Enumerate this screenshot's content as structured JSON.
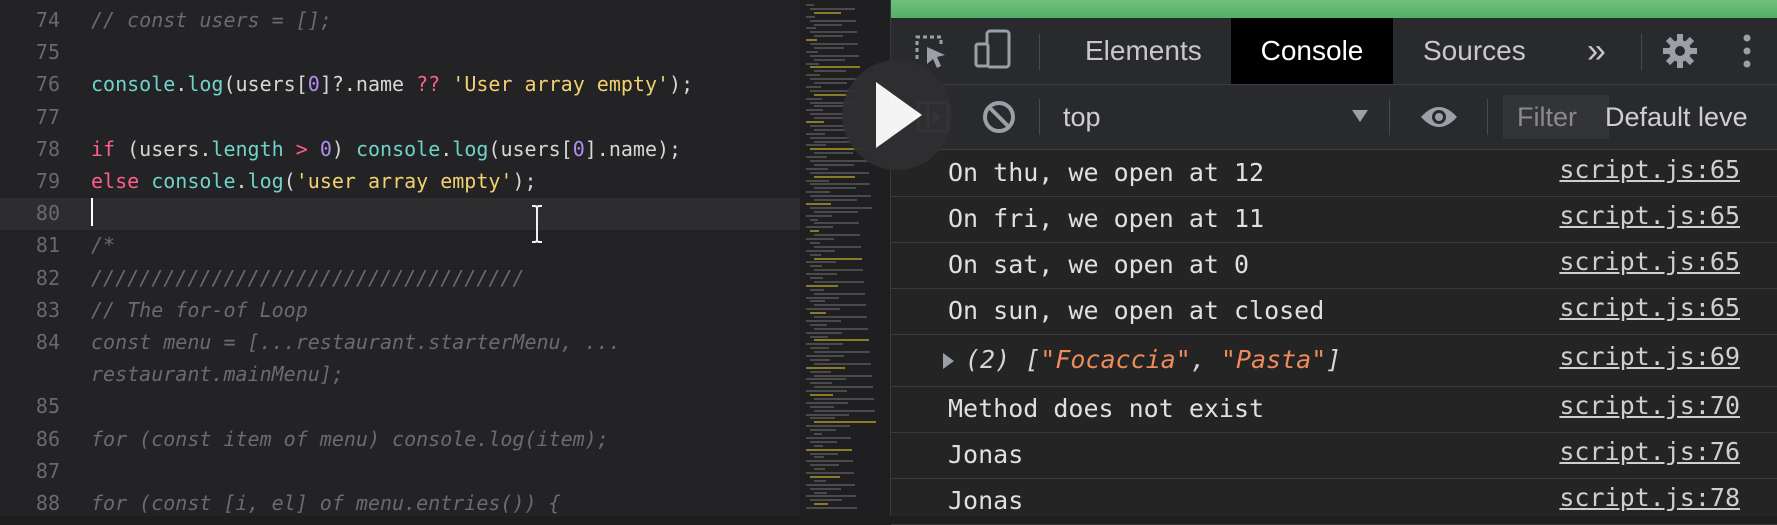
{
  "editor": {
    "lines": [
      {
        "num": "74",
        "tokens": [
          {
            "t": "// const users = [];",
            "c": "c"
          }
        ]
      },
      {
        "num": "75",
        "tokens": []
      },
      {
        "num": "76",
        "tokens": [
          {
            "t": "console",
            "c": "fn"
          },
          {
            "t": ".",
            "c": ""
          },
          {
            "t": "log",
            "c": "fn"
          },
          {
            "t": "(users[",
            "c": ""
          },
          {
            "t": "0",
            "c": "num"
          },
          {
            "t": "]?.name ",
            "c": ""
          },
          {
            "t": "??",
            "c": "kw"
          },
          {
            "t": " ",
            "c": ""
          },
          {
            "t": "'User array empty'",
            "c": "str"
          },
          {
            "t": ");",
            "c": ""
          }
        ]
      },
      {
        "num": "77",
        "tokens": []
      },
      {
        "num": "78",
        "tokens": [
          {
            "t": "if",
            "c": "kw"
          },
          {
            "t": " (users.",
            "c": ""
          },
          {
            "t": "length",
            "c": "fn"
          },
          {
            "t": " ",
            "c": ""
          },
          {
            "t": ">",
            "c": "kw"
          },
          {
            "t": " ",
            "c": ""
          },
          {
            "t": "0",
            "c": "num"
          },
          {
            "t": ") ",
            "c": ""
          },
          {
            "t": "console",
            "c": "fn"
          },
          {
            "t": ".",
            "c": ""
          },
          {
            "t": "log",
            "c": "fn"
          },
          {
            "t": "(users[",
            "c": ""
          },
          {
            "t": "0",
            "c": "num"
          },
          {
            "t": "].name);",
            "c": ""
          }
        ]
      },
      {
        "num": "79",
        "tokens": [
          {
            "t": "else",
            "c": "kw"
          },
          {
            "t": " ",
            "c": ""
          },
          {
            "t": "console",
            "c": "fn"
          },
          {
            "t": ".",
            "c": ""
          },
          {
            "t": "log",
            "c": "fn"
          },
          {
            "t": "(",
            "c": ""
          },
          {
            "t": "'user array empty'",
            "c": "str"
          },
          {
            "t": ");",
            "c": ""
          }
        ]
      },
      {
        "num": "80",
        "tokens": []
      },
      {
        "num": "81",
        "tokens": [
          {
            "t": "/*",
            "c": "c"
          }
        ]
      },
      {
        "num": "82",
        "tokens": [
          {
            "t": "////////////////////////////////////",
            "c": "c"
          }
        ]
      },
      {
        "num": "83",
        "tokens": [
          {
            "t": "// The for-of Loop",
            "c": "c"
          }
        ]
      },
      {
        "num": "84",
        "tokens": [
          {
            "t": "const menu = [...restaurant.starterMenu, ...",
            "c": "c"
          }
        ]
      },
      {
        "num": "",
        "tokens": [
          {
            "t": "restaurant.mainMenu];",
            "c": "c"
          }
        ]
      },
      {
        "num": "85",
        "tokens": []
      },
      {
        "num": "86",
        "tokens": [
          {
            "t": "for (const item of menu) console.log(item);",
            "c": "c"
          }
        ]
      },
      {
        "num": "87",
        "tokens": []
      },
      {
        "num": "88",
        "tokens": [
          {
            "t": "for (const [i, el] of menu.entries()) {",
            "c": "c"
          }
        ]
      }
    ]
  },
  "devtools": {
    "tabs": {
      "elements": "Elements",
      "console": "Console",
      "sources": "Sources",
      "more": "»"
    },
    "toolbar": {
      "context": "top",
      "filter_placeholder": "Filter",
      "levels": "Default leve"
    },
    "console_rows": [
      {
        "msg": "On thu, we open at 12",
        "src": "script.js:65"
      },
      {
        "msg": "On fri, we open at 11",
        "src": "script.js:65"
      },
      {
        "msg": "On sat, we open at 0",
        "src": "script.js:65"
      },
      {
        "msg": "On sun, we open at closed",
        "src": "script.js:65"
      },
      {
        "msg": "",
        "src": "script.js:69",
        "array": {
          "prefix": "(2) [",
          "items": [
            "\"Focaccia\"",
            "\"Pasta\""
          ],
          "suffix": "]"
        }
      },
      {
        "msg": "Method does not exist",
        "src": "script.js:70"
      },
      {
        "msg": "Jonas",
        "src": "script.js:76"
      },
      {
        "msg": "Jonas",
        "src": "script.js:78"
      }
    ],
    "colors": {
      "accent_bar": "#5cb870",
      "active_tab_bg": "#000000",
      "string": "#ef8a5a"
    }
  }
}
